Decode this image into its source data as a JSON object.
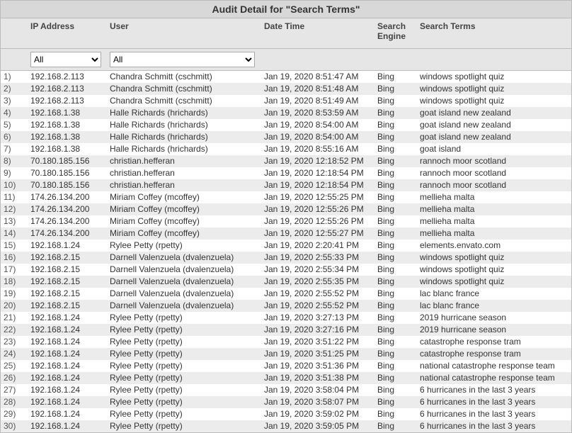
{
  "title": "Audit Detail for \"Search Terms\"",
  "columns": {
    "num": "",
    "ip": "IP Address",
    "user": "User",
    "datetime": "Date Time",
    "engine1": "Search",
    "engine2": "Engine",
    "terms": "Search Terms"
  },
  "filters": {
    "ip_selected": "All",
    "user_selected": "All"
  },
  "rows": [
    {
      "n": "1)",
      "ip": "192.168.2.113",
      "user": "Chandra Schmitt (cschmitt)",
      "dt": "Jan 19, 2020 8:51:47 AM",
      "eng": "Bing",
      "term": "windows spotlight quiz"
    },
    {
      "n": "2)",
      "ip": "192.168.2.113",
      "user": "Chandra Schmitt (cschmitt)",
      "dt": "Jan 19, 2020 8:51:48 AM",
      "eng": "Bing",
      "term": "windows spotlight quiz"
    },
    {
      "n": "3)",
      "ip": "192.168.2.113",
      "user": "Chandra Schmitt (cschmitt)",
      "dt": "Jan 19, 2020 8:51:49 AM",
      "eng": "Bing",
      "term": "windows spotlight quiz"
    },
    {
      "n": "4)",
      "ip": "192.168.1.38",
      "user": "Halle Richards (hrichards)",
      "dt": "Jan 19, 2020 8:53:59 AM",
      "eng": "Bing",
      "term": "goat island new zealand"
    },
    {
      "n": "5)",
      "ip": "192.168.1.38",
      "user": "Halle Richards (hrichards)",
      "dt": "Jan 19, 2020 8:54:00 AM",
      "eng": "Bing",
      "term": "goat island new zealand"
    },
    {
      "n": "6)",
      "ip": "192.168.1.38",
      "user": "Halle Richards (hrichards)",
      "dt": "Jan 19, 2020 8:54:00 AM",
      "eng": "Bing",
      "term": "goat island new zealand"
    },
    {
      "n": "7)",
      "ip": "192.168.1.38",
      "user": "Halle Richards (hrichards)",
      "dt": "Jan 19, 2020 8:55:16 AM",
      "eng": "Bing",
      "term": "goat island"
    },
    {
      "n": "8)",
      "ip": "70.180.185.156",
      "user": "christian.hefferan",
      "dt": "Jan 19, 2020 12:18:52 PM",
      "eng": "Bing",
      "term": "rannoch moor scotland"
    },
    {
      "n": "9)",
      "ip": "70.180.185.156",
      "user": "christian.hefferan",
      "dt": "Jan 19, 2020 12:18:54 PM",
      "eng": "Bing",
      "term": "rannoch moor scotland"
    },
    {
      "n": "10)",
      "ip": "70.180.185.156",
      "user": "christian.hefferan",
      "dt": "Jan 19, 2020 12:18:54 PM",
      "eng": "Bing",
      "term": "rannoch moor scotland"
    },
    {
      "n": "11)",
      "ip": "174.26.134.200",
      "user": "Miriam Coffey (mcoffey)",
      "dt": "Jan 19, 2020 12:55:25 PM",
      "eng": "Bing",
      "term": "mellieha malta"
    },
    {
      "n": "12)",
      "ip": "174.26.134.200",
      "user": "Miriam Coffey (mcoffey)",
      "dt": "Jan 19, 2020 12:55:26 PM",
      "eng": "Bing",
      "term": "mellieha malta"
    },
    {
      "n": "13)",
      "ip": "174.26.134.200",
      "user": "Miriam Coffey (mcoffey)",
      "dt": "Jan 19, 2020 12:55:26 PM",
      "eng": "Bing",
      "term": "mellieha malta"
    },
    {
      "n": "14)",
      "ip": "174.26.134.200",
      "user": "Miriam Coffey (mcoffey)",
      "dt": "Jan 19, 2020 12:55:27 PM",
      "eng": "Bing",
      "term": "mellieha malta"
    },
    {
      "n": "15)",
      "ip": "192.168.1.24",
      "user": "Rylee Petty (rpetty)",
      "dt": "Jan 19, 2020 2:20:41 PM",
      "eng": "Bing",
      "term": "elements.envato.com"
    },
    {
      "n": "16)",
      "ip": "192.168.2.15",
      "user": "Darnell Valenzuela (dvalenzuela)",
      "dt": "Jan 19, 2020 2:55:33 PM",
      "eng": "Bing",
      "term": "windows spotlight quiz"
    },
    {
      "n": "17)",
      "ip": "192.168.2.15",
      "user": "Darnell Valenzuela (dvalenzuela)",
      "dt": "Jan 19, 2020 2:55:34 PM",
      "eng": "Bing",
      "term": "windows spotlight quiz"
    },
    {
      "n": "18)",
      "ip": "192.168.2.15",
      "user": "Darnell Valenzuela (dvalenzuela)",
      "dt": "Jan 19, 2020 2:55:35 PM",
      "eng": "Bing",
      "term": "windows spotlight quiz"
    },
    {
      "n": "19)",
      "ip": "192.168.2.15",
      "user": "Darnell Valenzuela (dvalenzuela)",
      "dt": "Jan 19, 2020 2:55:52 PM",
      "eng": "Bing",
      "term": "lac blanc france"
    },
    {
      "n": "20)",
      "ip": "192.168.2.15",
      "user": "Darnell Valenzuela (dvalenzuela)",
      "dt": "Jan 19, 2020 2:55:52 PM",
      "eng": "Bing",
      "term": "lac blanc france"
    },
    {
      "n": "21)",
      "ip": "192.168.1.24",
      "user": "Rylee Petty (rpetty)",
      "dt": "Jan 19, 2020 3:27:13 PM",
      "eng": "Bing",
      "term": "2019 hurricane season"
    },
    {
      "n": "22)",
      "ip": "192.168.1.24",
      "user": "Rylee Petty (rpetty)",
      "dt": "Jan 19, 2020 3:27:16 PM",
      "eng": "Bing",
      "term": "2019 hurricane season"
    },
    {
      "n": "23)",
      "ip": "192.168.1.24",
      "user": "Rylee Petty (rpetty)",
      "dt": "Jan 19, 2020 3:51:22 PM",
      "eng": "Bing",
      "term": "catastrophe response tram"
    },
    {
      "n": "24)",
      "ip": "192.168.1.24",
      "user": "Rylee Petty (rpetty)",
      "dt": "Jan 19, 2020 3:51:25 PM",
      "eng": "Bing",
      "term": "catastrophe response tram"
    },
    {
      "n": "25)",
      "ip": "192.168.1.24",
      "user": "Rylee Petty (rpetty)",
      "dt": "Jan 19, 2020 3:51:36 PM",
      "eng": "Bing",
      "term": "national catastrophe response team"
    },
    {
      "n": "26)",
      "ip": "192.168.1.24",
      "user": "Rylee Petty (rpetty)",
      "dt": "Jan 19, 2020 3:51:38 PM",
      "eng": "Bing",
      "term": "national catastrophe response team"
    },
    {
      "n": "27)",
      "ip": "192.168.1.24",
      "user": "Rylee Petty (rpetty)",
      "dt": "Jan 19, 2020 3:58:04 PM",
      "eng": "Bing",
      "term": "6 hurricanes in the last 3 years"
    },
    {
      "n": "28)",
      "ip": "192.168.1.24",
      "user": "Rylee Petty (rpetty)",
      "dt": "Jan 19, 2020 3:58:07 PM",
      "eng": "Bing",
      "term": "6 hurricanes in the last 3 years"
    },
    {
      "n": "29)",
      "ip": "192.168.1.24",
      "user": "Rylee Petty (rpetty)",
      "dt": "Jan 19, 2020 3:59:02 PM",
      "eng": "Bing",
      "term": "6 hurricanes in the last 3 years"
    },
    {
      "n": "30)",
      "ip": "192.168.1.24",
      "user": "Rylee Petty (rpetty)",
      "dt": "Jan 19, 2020 3:59:05 PM",
      "eng": "Bing",
      "term": "6 hurricanes in the last 3 years"
    }
  ]
}
